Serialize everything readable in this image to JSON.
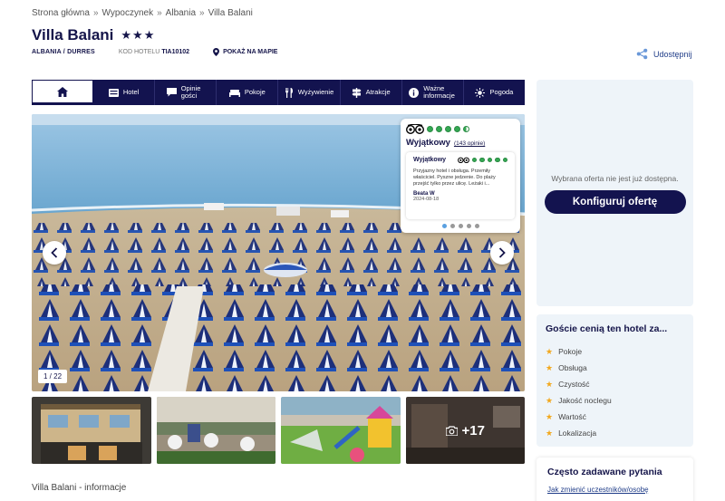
{
  "breadcrumb": {
    "items": [
      "Strona główna",
      "Wypoczynek",
      "Albania",
      "Villa Balani"
    ],
    "separator": "»"
  },
  "hotel": {
    "name": "Villa Balani",
    "stars": "★★★",
    "location": "ALBANIA / DURRES",
    "code_label": "KOD HOTELU",
    "code_value": "TIA10102",
    "map_link": "POKAŻ NA MAPIE"
  },
  "share": {
    "label": "Udostępnij",
    "icon": "share-icon"
  },
  "tabs": [
    {
      "label": "",
      "icon": "home-icon"
    },
    {
      "label": "Hotel",
      "icon": "hotel-icon"
    },
    {
      "label": "Opinie gości",
      "icon": "reviews-icon"
    },
    {
      "label": "Pokoje",
      "icon": "bed-icon"
    },
    {
      "label": "Wyżywienie",
      "icon": "cutlery-icon"
    },
    {
      "label": "Atrakcje",
      "icon": "signpost-icon"
    },
    {
      "label": "Ważne informacje",
      "icon": "info-icon"
    },
    {
      "label": "Pogoda",
      "icon": "sun-icon"
    }
  ],
  "gallery": {
    "counter": "1 / 22",
    "more_label": "+17"
  },
  "review": {
    "rating_word": "Wyjątkowy",
    "reviews_count": "(143 opinie)",
    "rating_bubbles": 4.5,
    "card_title": "Wyjątkowy",
    "card_bubbles": 5,
    "text": "Przyjazny hotel i obsługa. Przemiły właściciel. Pyszne jedzenie. Do plaży przejść tylko przez ulicę. Leżaki i...",
    "author": "Beata W",
    "date": "2024-08-18",
    "dots_total": 5,
    "dots_active": 0
  },
  "offer": {
    "message": "Wybrana oferta nie jest już dostępna.",
    "button": "Konfiguruj ofertę"
  },
  "values": {
    "title": "Goście cenią ten hotel za...",
    "items": [
      "Pokoje",
      "Obsługa",
      "Czystość",
      "Jakość noclegu",
      "Wartość",
      "Lokalizacja"
    ]
  },
  "faq": {
    "title": "Często zadawane pytania",
    "link": "Jak zmienić uczestników/osobę"
  },
  "info_title": "Villa Balani - informacje",
  "colors": {
    "navy": "#13134f",
    "accent_blue": "#1f3c88",
    "tripadvisor_green": "#34a853",
    "star_orange": "#f2a81d",
    "panel_bg": "#eef4f9"
  }
}
